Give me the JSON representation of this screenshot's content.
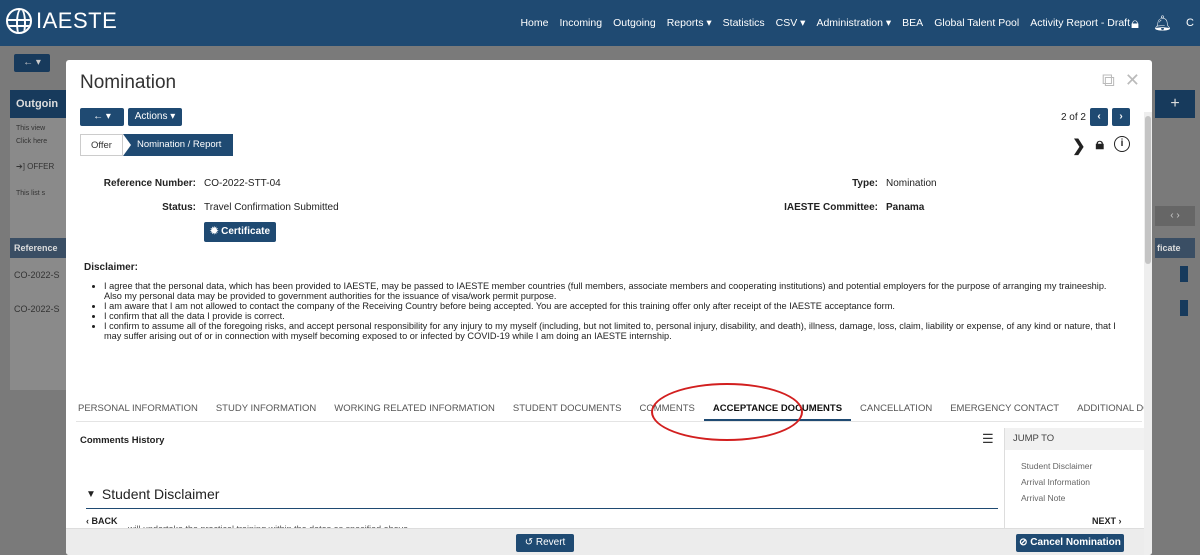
{
  "app": {
    "brand": "IAESTE"
  },
  "nav": {
    "links": [
      "Home",
      "Incoming",
      "Outgoing",
      "Reports ▾",
      "Statistics",
      "CSV ▾",
      "Administration ▾",
      "BEA",
      "Global Talent Pool",
      "Activity Report - Draft"
    ],
    "user_initial": "C"
  },
  "background": {
    "back_button": "← ▾",
    "panel_title": "Outgoin",
    "panel_lines": [
      "This view",
      "Click here"
    ],
    "offer_label": "➔] OFFER",
    "list_text": "This list s",
    "table_header": "Reference",
    "rows": [
      "CO-2022-S",
      "CO-2022-S"
    ],
    "right_plus": "+",
    "right_header": "ficate",
    "right_pager": "‹ ›"
  },
  "modal": {
    "title": "Nomination",
    "back_label": "← ▾",
    "actions_label": "Actions ▾",
    "pager_text": "2 of 2",
    "prev": "‹",
    "next": "›",
    "steps": {
      "offer": "Offer",
      "nomination": "Nomination / Report"
    },
    "fields": {
      "reference_label": "Reference Number:",
      "reference_value": "CO-2022-STT-04",
      "status_label": "Status:",
      "status_value": "Travel Confirmation Submitted",
      "type_label": "Type:",
      "type_value": "Nomination",
      "committee_label": "IAESTE Committee:",
      "committee_value": "Panama"
    },
    "certificate_label": "Certificate",
    "disclaimer_title": "Disclaimer:",
    "disclaimer_items": [
      "I agree that the personal data, which has been provided to IAESTE, may be passed to IAESTE member countries (full members, associate members and cooperating institutions) and potential employers for the purpose of arranging my traineeship. Also my personal data may be provided to government authorities for the issuance of visa/work permit purpose.",
      "I am aware that I am not allowed to contact the company of the Receiving Country before being accepted. You are accepted for this training offer only after receipt of the IAESTE acceptance form.",
      "I confirm that all the data I provide is correct.",
      "I confirm to assume all of the foregoing risks, and accept personal responsibility for any injury to my myself (including, but not limited to, personal injury, disability, and death), illness, damage, loss, claim, liability or expense, of any kind or nature, that I may suffer arising out of or in connection with myself becoming exposed to or infected by COVID-19 while I am doing an IAESTE internship."
    ],
    "tabs": [
      "PERSONAL INFORMATION",
      "STUDY INFORMATION",
      "WORKING RELATED INFORMATION",
      "STUDENT DOCUMENTS",
      "COMMENTS",
      "ACCEPTANCE DOCUMENTS",
      "CANCELLATION",
      "EMERGENCY CONTACT",
      "ADDITIONAL DOCUMENT"
    ],
    "active_tab": "ACCEPTANCE DOCUMENTS",
    "comments_history": "Comments History",
    "jump_to": {
      "title": "JUMP TO",
      "items": [
        "Student Disclaimer",
        "Arrival Information",
        "Arrival Note"
      ]
    },
    "section_title": "Student Disclaimer",
    "back_small": "‹ BACK",
    "next_small": "NEXT ›",
    "truncated_text": "will undertake the practical training within the dates as specified above",
    "revert_label": "Revert",
    "cancel_label": "Cancel Nomination"
  },
  "colors": {
    "navbar": "#1f4a72",
    "highlight_circle": "#d21f1f"
  }
}
